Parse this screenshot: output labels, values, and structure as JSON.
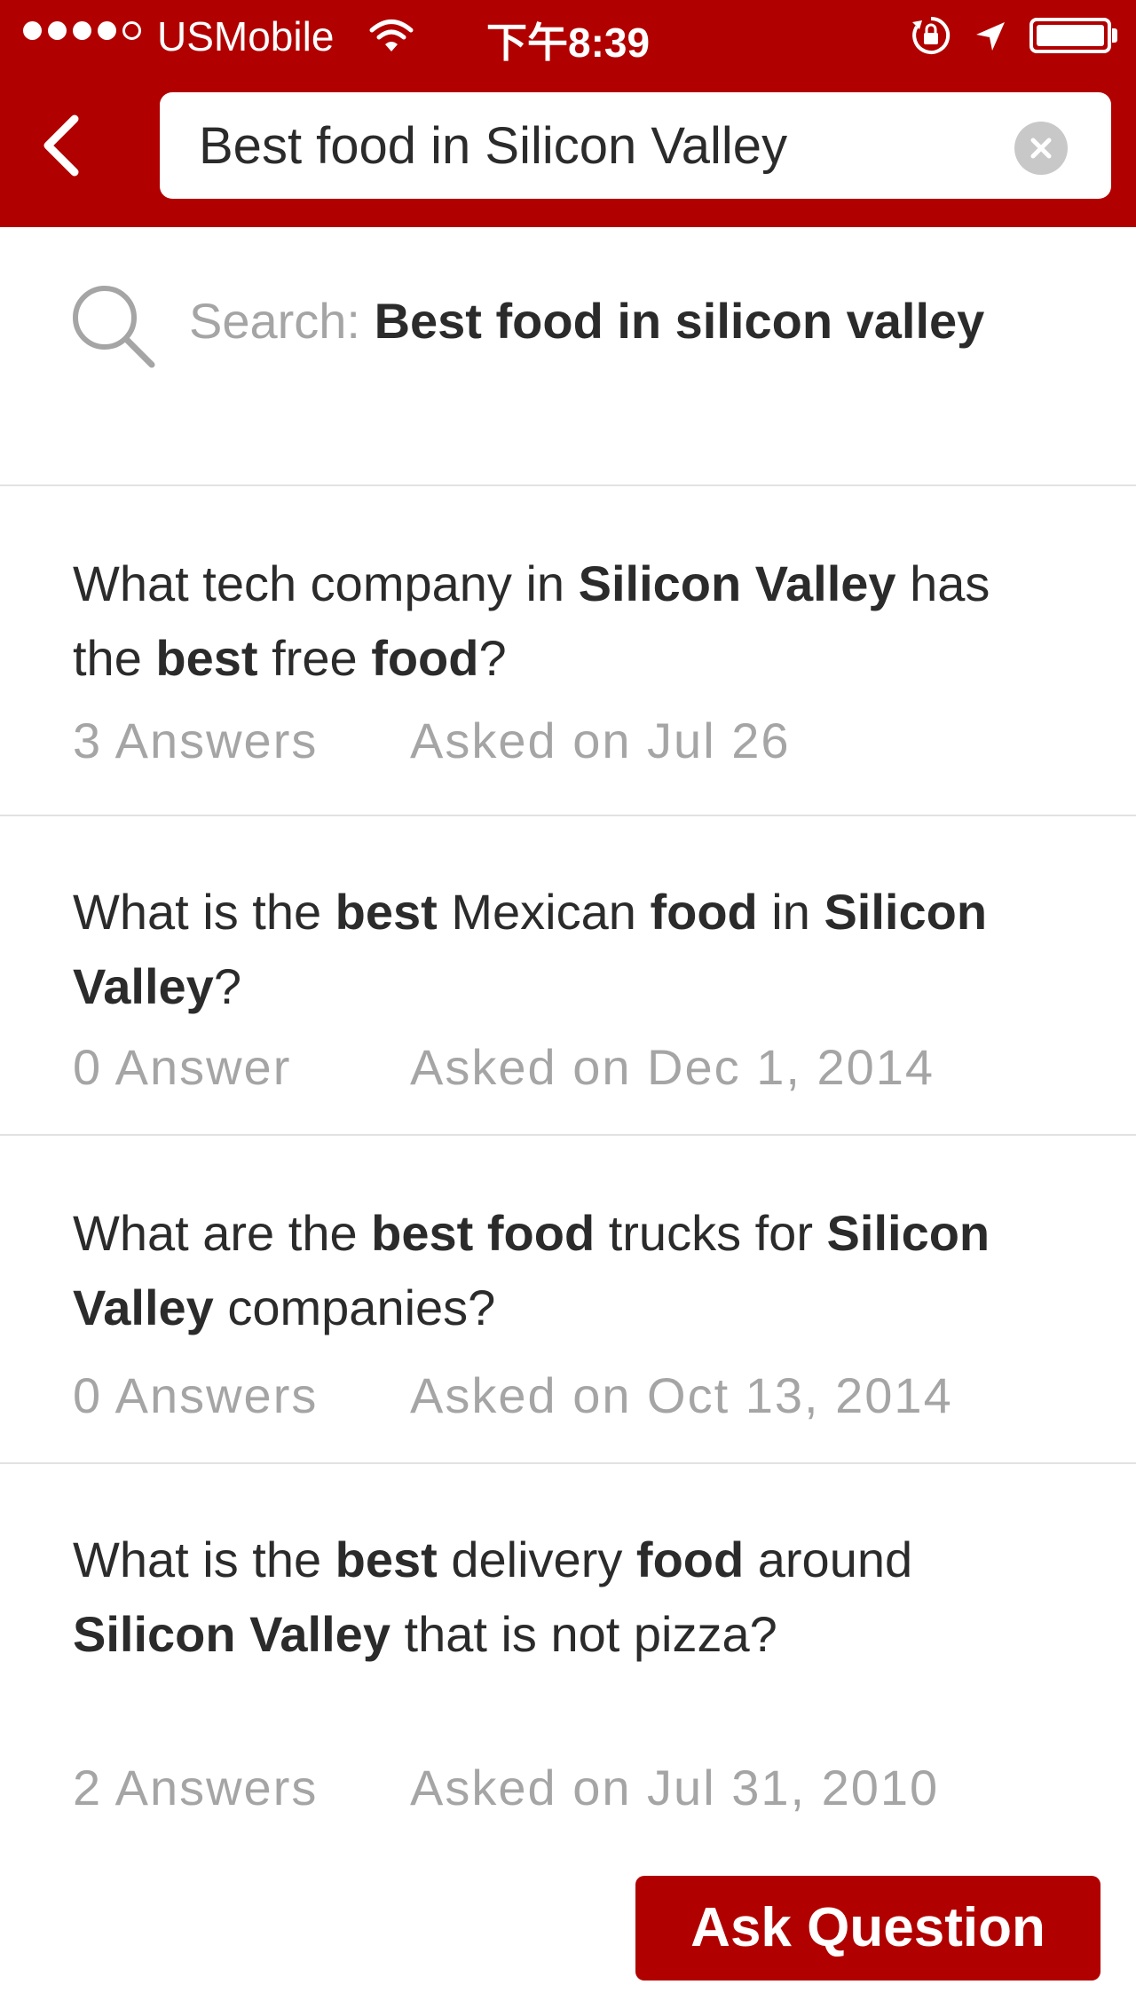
{
  "status_bar": {
    "carrier": "USMobile",
    "time": "下午8:39"
  },
  "search": {
    "value": "Best food in Silicon Valley"
  },
  "suggestion": {
    "prefix": "Search: ",
    "query": "Best food in silicon valley"
  },
  "questions": [
    {
      "title_parts": [
        {
          "text": "What tech company in ",
          "bold": false
        },
        {
          "text": "Silicon Valley",
          "bold": true
        },
        {
          "text": " has the ",
          "bold": false
        },
        {
          "text": "best",
          "bold": true
        },
        {
          "text": " free ",
          "bold": false
        },
        {
          "text": "food",
          "bold": true
        },
        {
          "text": "?",
          "bold": false
        }
      ],
      "answers": "3 Answers",
      "asked": "Asked on Jul 26"
    },
    {
      "title_parts": [
        {
          "text": "What is the ",
          "bold": false
        },
        {
          "text": "best",
          "bold": true
        },
        {
          "text": " Mexican ",
          "bold": false
        },
        {
          "text": "food",
          "bold": true
        },
        {
          "text": " in ",
          "bold": false
        },
        {
          "text": "Silicon Valley",
          "bold": true
        },
        {
          "text": "?",
          "bold": false
        }
      ],
      "answers": "0 Answer",
      "asked": "Asked on Dec 1, 2014"
    },
    {
      "title_parts": [
        {
          "text": "What are the ",
          "bold": false
        },
        {
          "text": "best food",
          "bold": true
        },
        {
          "text": " trucks for ",
          "bold": false
        },
        {
          "text": "Silicon Valley",
          "bold": true
        },
        {
          "text": " companies?",
          "bold": false
        }
      ],
      "answers": "0 Answers",
      "asked": "Asked on Oct 13, 2014"
    },
    {
      "title_parts": [
        {
          "text": "What is the ",
          "bold": false
        },
        {
          "text": "best",
          "bold": true
        },
        {
          "text": " delivery ",
          "bold": false
        },
        {
          "text": "food",
          "bold": true
        },
        {
          "text": " around ",
          "bold": false
        },
        {
          "text": "Silicon Valley",
          "bold": true
        },
        {
          "text": " that is not pizza?",
          "bold": false
        }
      ],
      "answers": "2 Answers",
      "asked": "Asked on Jul 31, 2010"
    }
  ],
  "bottom_bar": {
    "ask_label": "Ask Question"
  },
  "colors": {
    "brand_red": "#b10000",
    "muted_text": "#a5a5a5",
    "body_text": "#2b2b2b",
    "divider": "#e2e2e2"
  },
  "icons": [
    "back-chevron-icon",
    "clear-search-icon",
    "search-icon",
    "wifi-icon",
    "rotation-lock-icon",
    "location-arrow-icon",
    "battery-icon"
  ]
}
